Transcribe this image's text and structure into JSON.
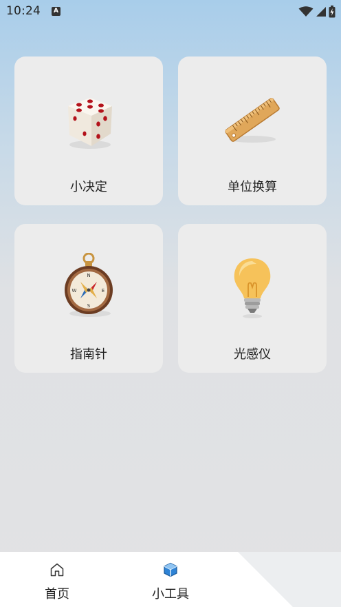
{
  "status_bar": {
    "time": "10:24",
    "notification_letter": "A"
  },
  "tools": [
    {
      "label": "小决定",
      "icon": "dice-icon"
    },
    {
      "label": "单位换算",
      "icon": "ruler-icon"
    },
    {
      "label": "指南针",
      "icon": "compass-icon"
    },
    {
      "label": "光感仪",
      "icon": "lightbulb-icon"
    }
  ],
  "bottom_nav": {
    "items": [
      {
        "label": "首页",
        "icon": "home-icon",
        "active": false
      },
      {
        "label": "小工具",
        "icon": "cube-icon",
        "active": true
      }
    ]
  },
  "colors": {
    "active_icon": "#2e83d6",
    "card_bg": "#ececec",
    "dice_pip": "#b3121b"
  }
}
